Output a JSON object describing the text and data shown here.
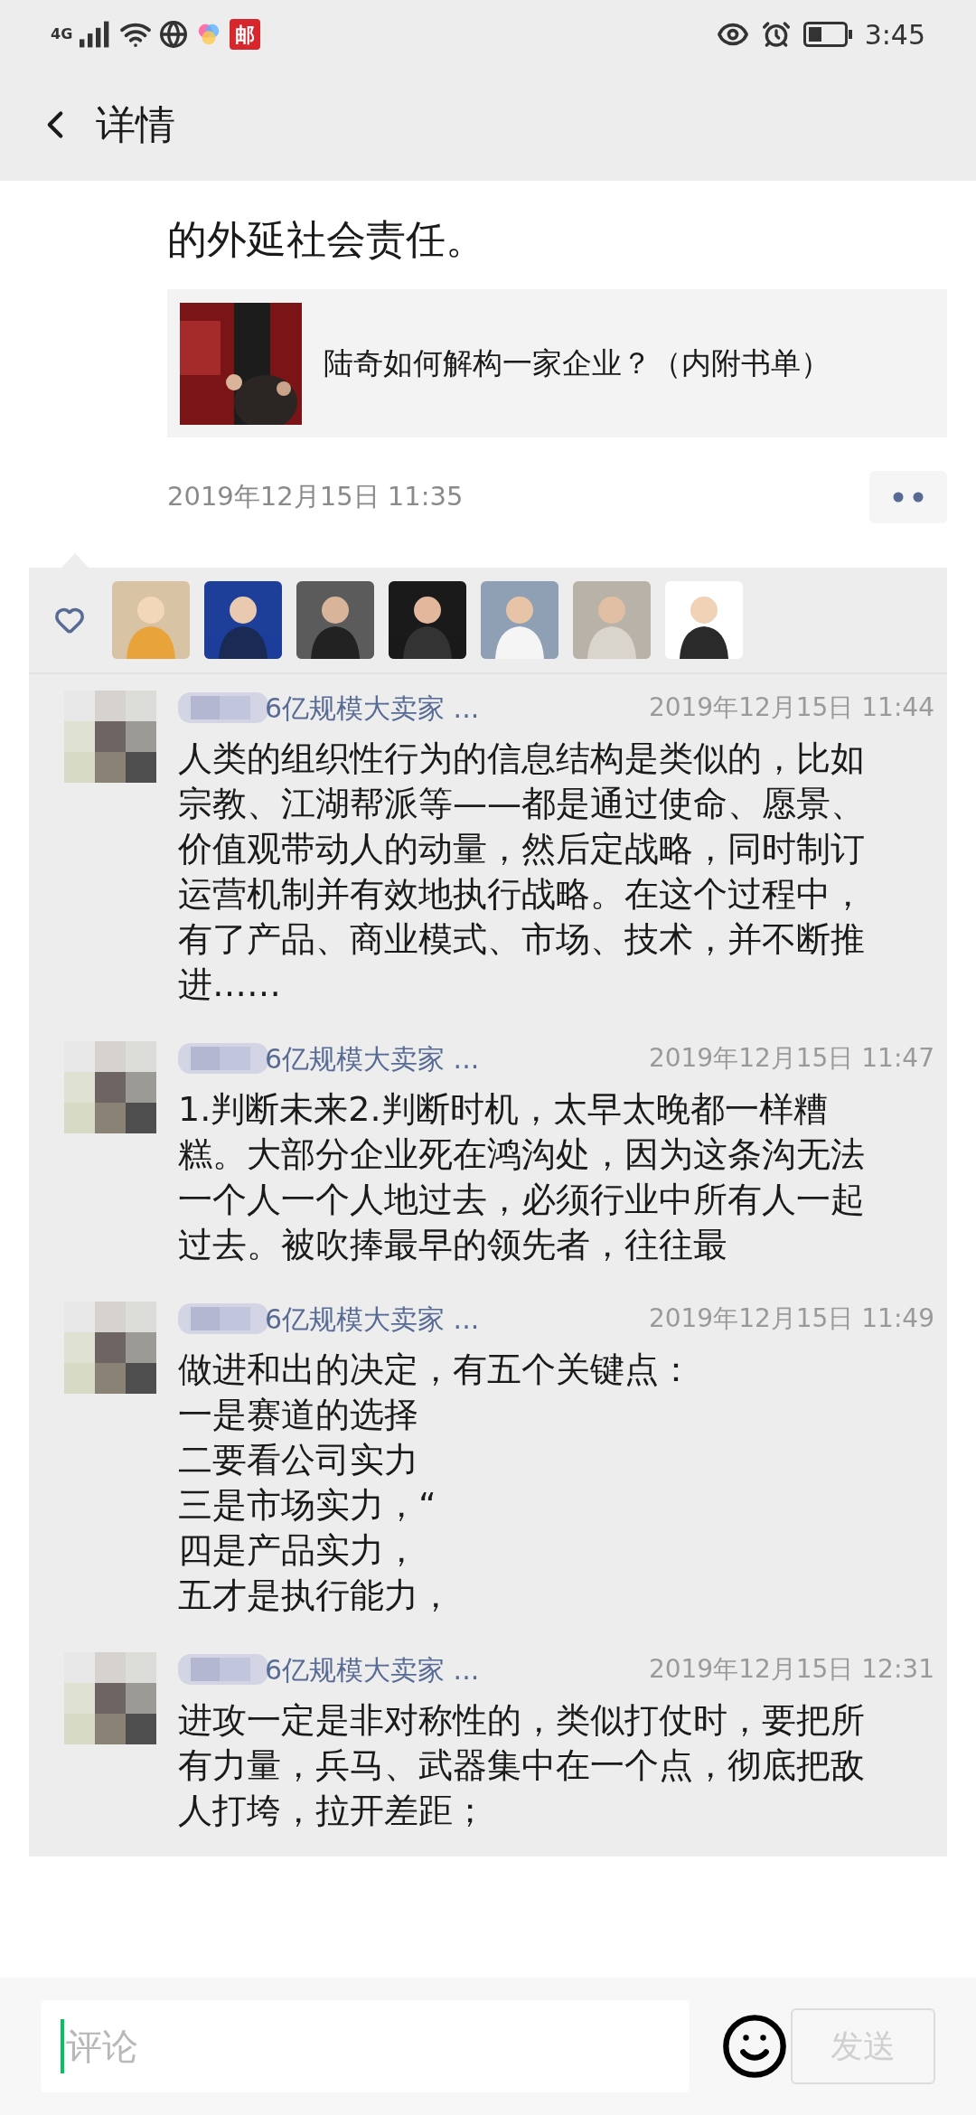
{
  "status_bar": {
    "network": "4G",
    "app_badge": "邮",
    "time": "3:45"
  },
  "header": {
    "title": "详情"
  },
  "post": {
    "text": "的外延社会责任。",
    "link": {
      "title": "陆奇如何解构一家企业？（内附书单）"
    },
    "time": "2019年12月15日 11:35"
  },
  "comments": [
    {
      "name": "6亿规模大卖家 ...",
      "time": "2019年12月15日 11:44",
      "lines": [
        "人类的组织性行为的信息结构是类似的，比如宗教、江湖帮派等——都是通过使命、愿景、价值观带动人的动量，然后定战略，同时制订运营机制并有效地执行战略。在这个过程中，有了产品、商业模式、市场、技术，并不断推进……"
      ]
    },
    {
      "name": "6亿规模大卖家 ...",
      "time": "2019年12月15日 11:47",
      "lines": [
        "1.判断未来2.判断时机，太早太晚都一样糟糕。大部分企业死在鸿沟处，因为这条沟无法一个人一个人地过去，必须行业中所有人一起过去。被吹捧最早的领先者，往往最"
      ]
    },
    {
      "name": "6亿规模大卖家 ...",
      "time": "2019年12月15日 11:49",
      "lines": [
        "做进和出的决定，有五个关键点：",
        "一是赛道的选择",
        "二要看公司实力",
        "三是市场实力，“",
        "四是产品实力，",
        "五才是执行能力，"
      ]
    },
    {
      "name": "6亿规模大卖家 ...",
      "time": "2019年12月15日 12:31",
      "lines": [
        "进攻一定是非对称性的，类似打仗时，要把所有力量，兵马、武器集中在一个点，彻底把敌人打垮，拉开差距；"
      ]
    }
  ],
  "composer": {
    "placeholder": "评论",
    "send": "发送",
    "send_disabled": true
  }
}
